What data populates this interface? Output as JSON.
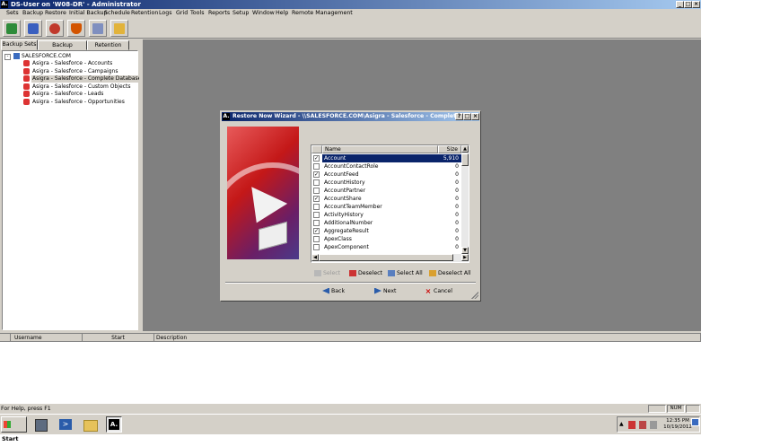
{
  "window": {
    "title": "DS-User on 'W08-DR' - Administrator",
    "icon_glyph": "A."
  },
  "menu": [
    "Sets",
    "Backup",
    "Restore",
    "Initial Backup",
    "Schedule",
    "Retention",
    "Logs",
    "Grid",
    "Tools",
    "Reports",
    "Setup",
    "Window",
    "Help",
    "Remote Management"
  ],
  "toolbar": {
    "icons": [
      "backup-icon",
      "restore-icon",
      "undo-icon",
      "shield-icon",
      "schedule-icon",
      "wizard-icon"
    ]
  },
  "tabs": [
    {
      "label": "Backup Sets",
      "active": true
    },
    {
      "label": "Backup Schedules",
      "active": false
    },
    {
      "label": "Retention Rules",
      "active": false
    }
  ],
  "tree": {
    "root": "SALESFORCE.COM",
    "items": [
      "Asigra - Salesforce - Accounts",
      "Asigra - Salesforce - Campaigns",
      "Asigra - Salesforce - Complete Database",
      "Asigra - Salesforce - Custom Objects",
      "Asigra - Salesforce - Leads",
      "Asigra - Salesforce - Opportunities"
    ],
    "selected_index": 2
  },
  "grid": {
    "columns": [
      "Username",
      "Start",
      "Description"
    ]
  },
  "status": {
    "text": "For Help, press F1",
    "num": "NUM"
  },
  "taskbar": {
    "start": "Start",
    "time": "12:35 PM",
    "date": "10/19/2012"
  },
  "dialog": {
    "title": "Restore Now Wizard - \\\\SALESFORCE.COM\\Asigra - Salesforce - Complete Database",
    "columns": {
      "name": "Name",
      "size": "Size"
    },
    "rows": [
      {
        "name": "Account",
        "size": "5,910",
        "checked": true,
        "selected": true
      },
      {
        "name": "AccountContactRole",
        "size": "0",
        "checked": false
      },
      {
        "name": "AccountFeed",
        "size": "0",
        "checked": true
      },
      {
        "name": "AccountHistory",
        "size": "0",
        "checked": false
      },
      {
        "name": "AccountPartner",
        "size": "0",
        "checked": false
      },
      {
        "name": "AccountShare",
        "size": "0",
        "checked": true
      },
      {
        "name": "AccountTeamMember",
        "size": "0",
        "checked": false
      },
      {
        "name": "ActivityHistory",
        "size": "0",
        "checked": false
      },
      {
        "name": "AdditionalNumber",
        "size": "0",
        "checked": false
      },
      {
        "name": "AggregateResult",
        "size": "0",
        "checked": true
      },
      {
        "name": "ApexClass",
        "size": "0",
        "checked": false
      },
      {
        "name": "ApexComponent",
        "size": "0",
        "checked": false
      }
    ],
    "buttons": {
      "select": "Select",
      "deselect": "Deselect",
      "select_all": "Select All",
      "deselect_all": "Deselect All",
      "back": "Back",
      "next": "Next",
      "cancel": "Cancel"
    }
  }
}
